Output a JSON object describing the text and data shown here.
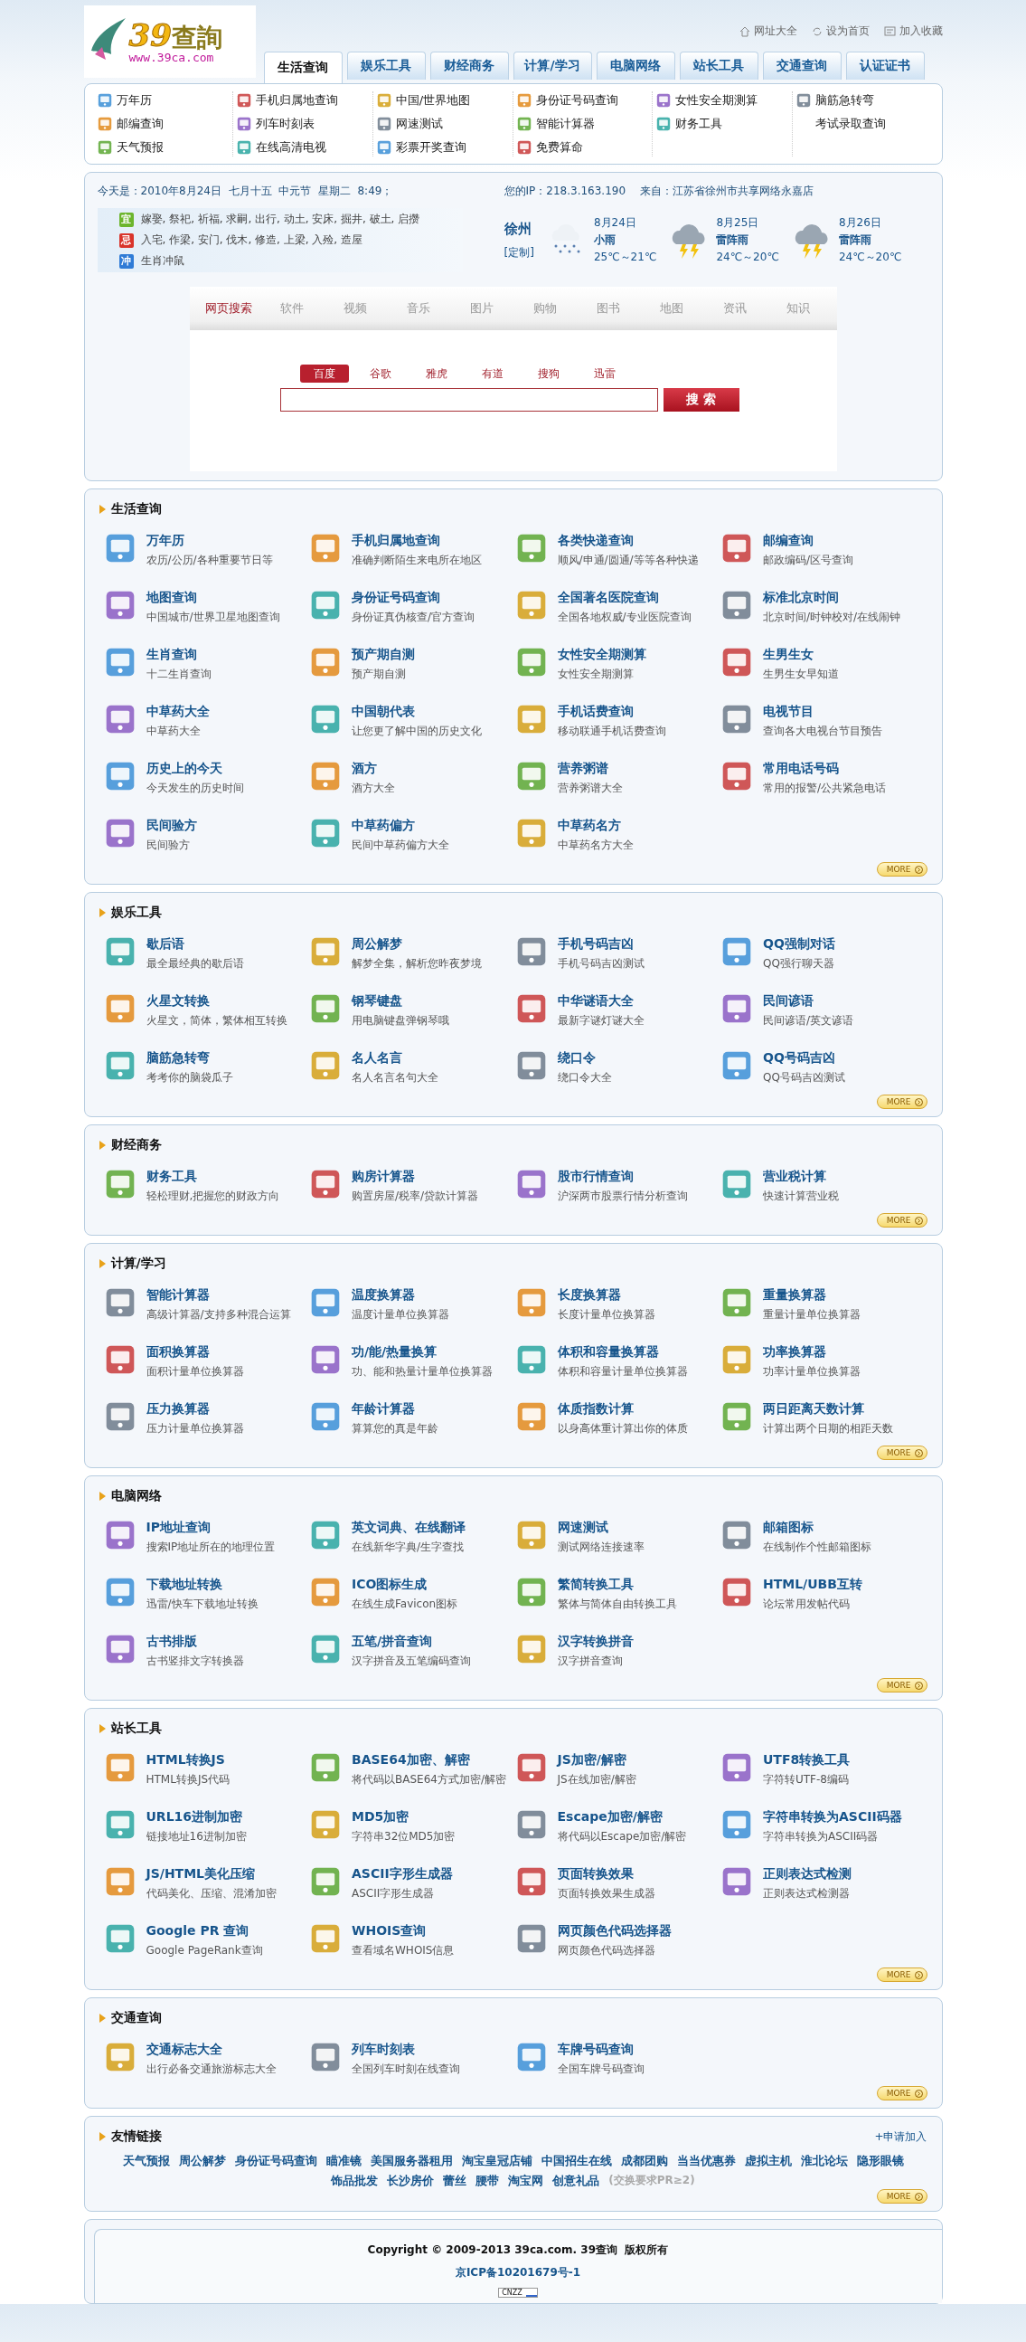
{
  "logo": {
    "mark": "39",
    "name": "查詢",
    "url": "www.39ca.com"
  },
  "top_links": [
    {
      "label": "网址大全",
      "kind": "home"
    },
    {
      "label": "设为首页",
      "kind": "cycle"
    },
    {
      "label": "加入收藏",
      "kind": "card"
    }
  ],
  "tabs": [
    {
      "label": "生活查询",
      "selected": true
    },
    {
      "label": "娱乐工具",
      "selected": false
    },
    {
      "label": "财经商务",
      "selected": false
    },
    {
      "label": "计算/学习",
      "selected": false
    },
    {
      "label": "电脑网络",
      "selected": false
    },
    {
      "label": "站长工具",
      "selected": false
    },
    {
      "label": "交通查询",
      "selected": false
    },
    {
      "label": "认证证书",
      "selected": false
    }
  ],
  "quick_links": [
    [
      {
        "label": "万年历",
        "icon": true
      },
      {
        "label": "邮编查询",
        "icon": true
      },
      {
        "label": "天气预报",
        "icon": true
      }
    ],
    [
      {
        "label": "手机归属地查询",
        "icon": true
      },
      {
        "label": "列车时刻表",
        "icon": true
      },
      {
        "label": "在线高清电视",
        "icon": true
      }
    ],
    [
      {
        "label": "中国/世界地图",
        "icon": true
      },
      {
        "label": "网速测试",
        "icon": true
      },
      {
        "label": "彩票开奖查询",
        "icon": true
      }
    ],
    [
      {
        "label": "身份证号码查询",
        "icon": true
      },
      {
        "label": "智能计算器",
        "icon": true
      },
      {
        "label": "免费算命",
        "icon": true
      }
    ],
    [
      {
        "label": "女性安全期测算",
        "icon": true
      },
      {
        "label": "财务工具",
        "icon": true
      }
    ],
    [
      {
        "label": "脑筋急转弯",
        "icon": true
      },
      {
        "label": "考试录取查询",
        "icon": false
      }
    ]
  ],
  "today": {
    "label": "今天是：",
    "value": "2010年8月24日  七月十五  中元节  星期二  8:49；"
  },
  "visitor": {
    "ip": "您的IP：218.3.163.190",
    "from": "来自：江苏省徐州市共享网络永嘉店"
  },
  "almanac": [
    {
      "badge": "宜",
      "color": "#6cb52d",
      "text": "嫁娶, 祭祀, 祈福, 求嗣, 出行, 动土, 安床, 掘井, 破土, 启攒"
    },
    {
      "badge": "忌",
      "color": "#d9342b",
      "text": "入宅, 作梁, 安门, 伐木, 修造, 上梁, 入殓, 造屋"
    },
    {
      "badge": "冲",
      "color": "#2f7bd6",
      "text": "生肖冲鼠"
    }
  ],
  "weather": {
    "city": "徐州",
    "customize": "[定制]",
    "days": [
      {
        "date": "8月24日",
        "condition": "小雨",
        "temp": "25℃～21℃",
        "kind": "rain"
      },
      {
        "date": "8月25日",
        "condition": "雷阵雨",
        "temp": "24℃～20℃",
        "kind": "thunderstorm"
      },
      {
        "date": "8月26日",
        "condition": "雷阵雨",
        "temp": "24℃～20℃",
        "kind": "thunderstorm"
      }
    ]
  },
  "search": {
    "categories": [
      {
        "label": "网页搜索",
        "selected": true
      },
      {
        "label": "软件",
        "selected": false
      },
      {
        "label": "视频",
        "selected": false
      },
      {
        "label": "音乐",
        "selected": false
      },
      {
        "label": "图片",
        "selected": false
      },
      {
        "label": "购物",
        "selected": false
      },
      {
        "label": "图书",
        "selected": false
      },
      {
        "label": "地图",
        "selected": false
      },
      {
        "label": "资讯",
        "selected": false
      },
      {
        "label": "知识",
        "selected": false
      }
    ],
    "engines": [
      {
        "label": "百度",
        "selected": true
      },
      {
        "label": "谷歌",
        "selected": false
      },
      {
        "label": "雅虎",
        "selected": false
      },
      {
        "label": "有道",
        "selected": false
      },
      {
        "label": "搜狗",
        "selected": false
      },
      {
        "label": "迅雷",
        "selected": false
      }
    ],
    "button": "搜 索"
  },
  "sections": [
    {
      "title": "生活查询",
      "more": "MORE",
      "items": [
        {
          "title": "万年历",
          "desc": "农历/公历/各种重要节日等"
        },
        {
          "title": "手机归属地查询",
          "desc": "准确判断陌生来电所在地区"
        },
        {
          "title": "各类快递查询",
          "desc": "顺风/申通/圆通/等等各种快递"
        },
        {
          "title": "邮编查询",
          "desc": "邮政编码/区号查询"
        },
        {
          "title": "地图查询",
          "desc": "中国城市/世界卫星地图查询"
        },
        {
          "title": "身份证号码查询",
          "desc": "身份证真伪核查/官方查询"
        },
        {
          "title": "全国著名医院查询",
          "desc": "全国各地权威/专业医院查询"
        },
        {
          "title": "标准北京时间",
          "desc": "北京时间/时钟校对/在线闹钟"
        },
        {
          "title": "生肖查询",
          "desc": "十二生肖查询"
        },
        {
          "title": "预产期自测",
          "desc": "预产期自测"
        },
        {
          "title": "女性安全期测算",
          "desc": "女性安全期测算"
        },
        {
          "title": "生男生女",
          "desc": "生男生女早知道"
        },
        {
          "title": "中草药大全",
          "desc": "中草药大全"
        },
        {
          "title": "中国朝代表",
          "desc": "让您更了解中国的历史文化"
        },
        {
          "title": "手机话费查询",
          "desc": "移动联通手机话费查询"
        },
        {
          "title": "电视节目",
          "desc": "查询各大电视台节目预告"
        },
        {
          "title": "历史上的今天",
          "desc": "今天发生的历史时间"
        },
        {
          "title": "酒方",
          "desc": "酒方大全"
        },
        {
          "title": "营养粥谱",
          "desc": "营养粥谱大全"
        },
        {
          "title": "常用电话号码",
          "desc": "常用的报警/公共紧急电话"
        },
        {
          "title": "民间验方",
          "desc": "民间验方"
        },
        {
          "title": "中草药偏方",
          "desc": "民间中草药偏方大全"
        },
        {
          "title": "中草药名方",
          "desc": "中草药名方大全"
        }
      ]
    },
    {
      "title": "娱乐工具",
      "more": "MORE",
      "items": [
        {
          "title": "歇后语",
          "desc": "最全最经典的歇后语"
        },
        {
          "title": "周公解梦",
          "desc": "解梦全集，解析您昨夜梦境"
        },
        {
          "title": "手机号码吉凶",
          "desc": "手机号码吉凶测试"
        },
        {
          "title": "QQ强制对话",
          "desc": "QQ强行聊天器"
        },
        {
          "title": "火星文转换",
          "desc": "火星文，简体，繁体相互转换"
        },
        {
          "title": "钢琴键盘",
          "desc": "用电脑键盘弹钢琴哦"
        },
        {
          "title": "中华谜语大全",
          "desc": "最新字谜灯谜大全"
        },
        {
          "title": "民间谚语",
          "desc": "民间谚语/英文谚语"
        },
        {
          "title": "脑筋急转弯",
          "desc": "考考你的脑袋瓜子"
        },
        {
          "title": "名人名言",
          "desc": "名人名言名句大全"
        },
        {
          "title": "绕口令",
          "desc": "绕口令大全"
        },
        {
          "title": "QQ号码吉凶",
          "desc": "QQ号码吉凶测试"
        }
      ]
    },
    {
      "title": "财经商务",
      "more": "MORE",
      "items": [
        {
          "title": "财务工具",
          "desc": "轻松理财,把握您的财政方向"
        },
        {
          "title": "购房计算器",
          "desc": "购置房屋/税率/贷款计算器"
        },
        {
          "title": "股市行情查询",
          "desc": "沪深两市股票行情分析查询"
        },
        {
          "title": "营业税计算",
          "desc": "快速计算营业税"
        }
      ]
    },
    {
      "title": "计算/学习",
      "more": "MORE",
      "items": [
        {
          "title": "智能计算器",
          "desc": "高级计算器/支持多种混合运算"
        },
        {
          "title": "温度换算器",
          "desc": "温度计量单位换算器"
        },
        {
          "title": "长度换算器",
          "desc": "长度计量单位换算器"
        },
        {
          "title": "重量换算器",
          "desc": "重量计量单位换算器"
        },
        {
          "title": "面积换算器",
          "desc": "面积计量单位换算器"
        },
        {
          "title": "功/能/热量换算",
          "desc": "功、能和热量计量单位换算器"
        },
        {
          "title": "体积和容量换算器",
          "desc": "体积和容量计量单位换算器"
        },
        {
          "title": "功率换算器",
          "desc": "功率计量单位换算器"
        },
        {
          "title": "压力换算器",
          "desc": "压力计量单位换算器"
        },
        {
          "title": "年龄计算器",
          "desc": "算算您的真是年龄"
        },
        {
          "title": "体质指数计算",
          "desc": "以身高体重计算出你的体质"
        },
        {
          "title": "两日距离天数计算",
          "desc": "计算出两个日期的相距天数"
        }
      ]
    },
    {
      "title": "电脑网络",
      "more": "MORE",
      "items": [
        {
          "title": "IP地址查询",
          "desc": "搜索IP地址所在的地理位置"
        },
        {
          "title": "英文词典、在线翻译",
          "desc": "在线新华字典/生字查找"
        },
        {
          "title": "网速测试",
          "desc": "测试网络连接速率"
        },
        {
          "title": "邮箱图标",
          "desc": "在线制作个性邮箱图标"
        },
        {
          "title": "下载地址转换",
          "desc": "迅雷/快车下载地址转换"
        },
        {
          "title": "ICO图标生成",
          "desc": "在线生成Favicon图标"
        },
        {
          "title": "繁简转换工具",
          "desc": "繁体与简体自由转换工具"
        },
        {
          "title": "HTML/UBB互转",
          "desc": "论坛常用发帖代码"
        },
        {
          "title": "古书排版",
          "desc": "古书竖排文字转换器"
        },
        {
          "title": "五笔/拼音查询",
          "desc": "汉字拼音及五笔编码查询"
        },
        {
          "title": "汉字转换拼音",
          "desc": "汉字拼音查询"
        }
      ]
    },
    {
      "title": "站长工具",
      "more": "MORE",
      "items": [
        {
          "title": "HTML转换JS",
          "desc": "HTML转换JS代码"
        },
        {
          "title": "BASE64加密、解密",
          "desc": "将代码以BASE64方式加密/解密"
        },
        {
          "title": "JS加密/解密",
          "desc": "JS在线加密/解密"
        },
        {
          "title": "UTF8转换工具",
          "desc": "字符转UTF-8编码"
        },
        {
          "title": "URL16进制加密",
          "desc": "链接地址16进制加密"
        },
        {
          "title": "MD5加密",
          "desc": "字符串32位MD5加密"
        },
        {
          "title": "Escape加密/解密",
          "desc": "将代码以Escape加密/解密"
        },
        {
          "title": "字符串转换为ASCII码器",
          "desc": "字符串转换为ASCII码器"
        },
        {
          "title": "JS/HTML美化压缩",
          "desc": "代码美化、压缩、混淆加密"
        },
        {
          "title": "ASCII字形生成器",
          "desc": "ASCII字形生成器"
        },
        {
          "title": "页面转换效果",
          "desc": "页面转换效果生成器"
        },
        {
          "title": "正则表达式检测",
          "desc": "正则表达式检测器"
        },
        {
          "title": "Google PR 查询",
          "desc": "Google PageRank查询"
        },
        {
          "title": "WHOIS查询",
          "desc": "查看域名WHOIS信息"
        },
        {
          "title": "网页颜色代码选择器",
          "desc": "网页颜色代码选择器"
        }
      ]
    },
    {
      "title": "交通查询",
      "more": "MORE",
      "items": [
        {
          "title": "交通标志大全",
          "desc": "出行必备交通旅游标志大全"
        },
        {
          "title": "列车时刻表",
          "desc": "全国列车时刻在线查询"
        },
        {
          "title": "车牌号码查询",
          "desc": "全国车牌号码查询"
        }
      ]
    }
  ],
  "friend_links": {
    "title": "友情链接",
    "apply": "+申请加入",
    "links": [
      "天气预报",
      "周公解梦",
      "身份证号码查询",
      "瞄准镜",
      "美国服务器租用",
      "淘宝皇冠店铺",
      "中国招生在线",
      "成都团购",
      "当当优惠券",
      "虚拟主机",
      "淮北论坛",
      "隐形眼镜",
      "饰品批发",
      "长沙房价",
      "蕾丝",
      "腰带",
      "淘宝网",
      "创意礼品"
    ],
    "note": "(交换要求PR≥2)",
    "more": "MORE"
  },
  "footer": {
    "copyright": "Copyright © 2009-2013 39ca.com. 39查询  版权所有",
    "icp": "京ICP备10201679号-1",
    "counter": "CNZZ"
  }
}
